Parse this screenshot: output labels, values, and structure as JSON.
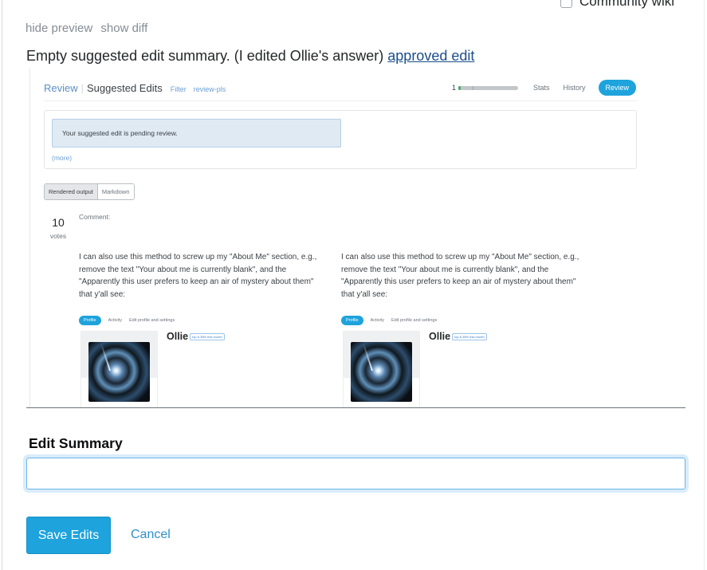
{
  "community_wiki": {
    "label": "Community wiki",
    "checked": false
  },
  "preview_links": {
    "hide_preview": "hide preview",
    "show_diff": "show diff"
  },
  "summary": {
    "text": "Empty suggested edit summary. (I edited Ollie's answer) ",
    "link": "approved edit"
  },
  "embedded_screenshot": {
    "header": {
      "review": "Review",
      "separator": "|",
      "title": "Suggested Edits",
      "filter": "Filter",
      "tag": "review-pls"
    },
    "progress": {
      "count": "1",
      "fraction": 0.04
    },
    "nav": {
      "stats": "Stats",
      "history": "History",
      "review": "Review"
    },
    "notice": "Your suggested edit is pending review.",
    "more": "(more)",
    "tabs": {
      "rendered": "Rendered output",
      "markdown": "Markdown"
    },
    "votes": {
      "count": "10",
      "label": "votes"
    },
    "comment_label": "Comment:",
    "columns": [
      {
        "body": "I can also use this method to screw up my \"About Me\" section, e.g., remove the text \"Your about me is currently blank\", and the \"Apparently this user prefers to keep an air of mystery about them\" that y'all see:",
        "profile_nav": {
          "profile": "Profile",
          "activity": "Activity",
          "settings": "Edit profile and settings"
        },
        "username": "Ollie",
        "badge": "top 6.38% this month"
      },
      {
        "body": "I can also use this method to screw up my \"About Me\" section, e.g., remove the text \"Your about me is currently blank\", and the \"Apparently this user prefers to keep an air of mystery about them\" that y'all see:",
        "profile_nav": {
          "profile": "Profile",
          "activity": "Activity",
          "settings": "Edit profile and settings"
        },
        "username": "Ollie",
        "badge": "top 6.38% this month"
      }
    ]
  },
  "edit_summary": {
    "label": "Edit Summary",
    "value": "",
    "placeholder": ""
  },
  "actions": {
    "save": "Save Edits",
    "cancel": "Cancel"
  },
  "colors": {
    "accent": "#1ea3dc",
    "link": "#1a4e8a",
    "notice_bg": "#dfeaf3",
    "progress_fill": "#48a868"
  }
}
